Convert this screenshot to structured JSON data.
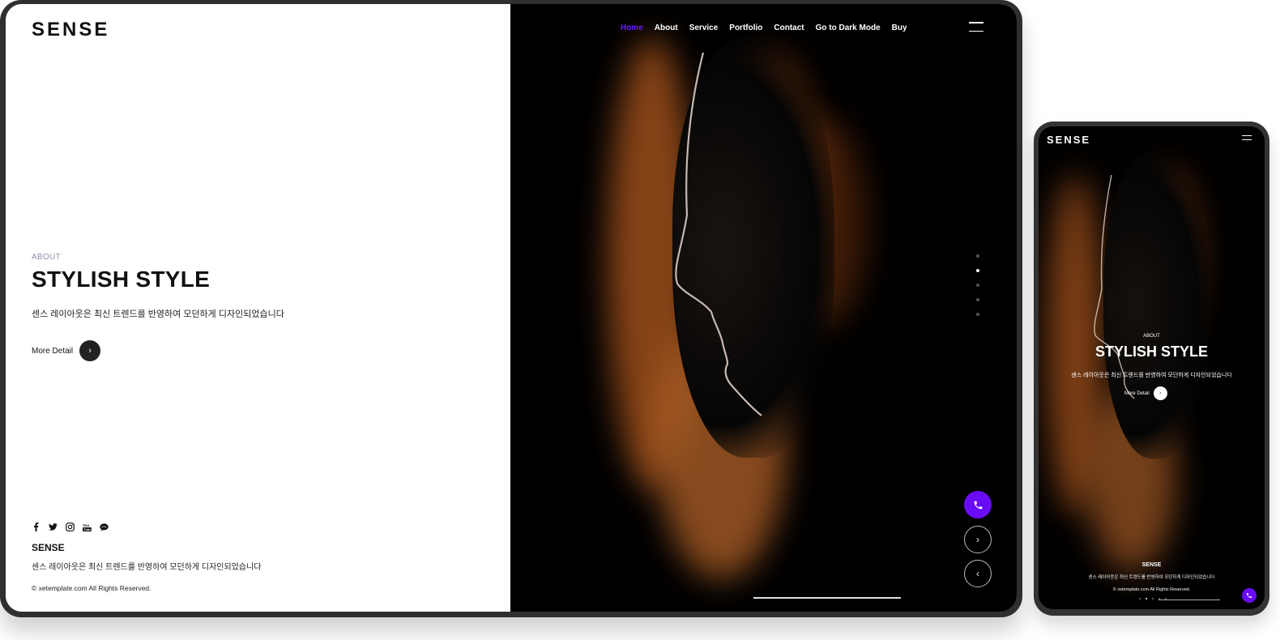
{
  "desktop": {
    "logo": "SENSE",
    "nav": [
      "Home",
      "About",
      "Service",
      "Portfolio",
      "Contact",
      "Go to Dark Mode",
      "Buy"
    ],
    "nav_active_index": 0,
    "hero": {
      "eyebrow": "ABOUT",
      "title": "STYLISH STYLE",
      "description": "센스 레이아웃은 최신 트렌드를 반영하여 모던하게 디자인되었습니다",
      "button_label": "More Detail"
    },
    "footer": {
      "social_icons": [
        "facebook-icon",
        "twitter-icon",
        "instagram-icon",
        "youtube-icon",
        "chat-icon"
      ],
      "brand": "SENSE",
      "description": "센스 레이아웃은 최신 트렌드를 반영하여 모던하게 디자인되었습니다",
      "copyright": "© xetemplate.com All Rights Reserved."
    },
    "slides": {
      "count": 5,
      "active_index": 1
    }
  },
  "mobile": {
    "logo": "SENSE",
    "hero": {
      "eyebrow": "ABOUT",
      "title": "STYLISH STYLE",
      "description": "센스 레이아웃은 최신 트렌드를 반영하여 모던하게 디자인되었습니다",
      "button_label": "More Detail"
    },
    "footer": {
      "brand": "SENSE",
      "description": "센스 레이아웃은 최신 트렌드를 반영하여 모던하게 디자인되었습니다",
      "copyright": "© xetemplate.com All Rights Reserved."
    }
  },
  "colors": {
    "accent": "#6a0bf5",
    "dark": "#111111",
    "eyebrow": "#8a93a8"
  }
}
